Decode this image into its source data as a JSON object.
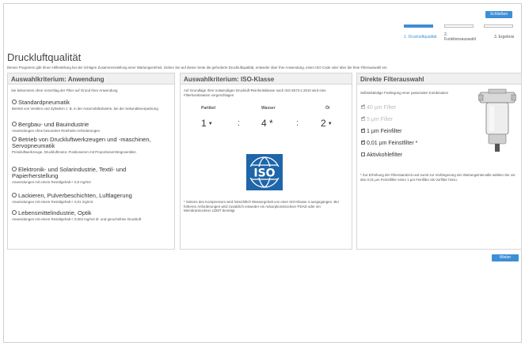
{
  "header": {
    "close_label": "Schließen"
  },
  "steps": [
    {
      "label": "1. Druckluftqualität",
      "active": true
    },
    {
      "label": "2. Funktionsauswahl",
      "active": false
    },
    {
      "label": "3. Ergebnis",
      "active": false
    }
  ],
  "page": {
    "title": "Druckluftqualität",
    "intro": "Dieses Programm gibt Ihnen Hilfestellung bei der richtigen Zusammenstellung einer Wartungseinheit. Geben Sie auf dieser Seite die geforderte Druckluftqualität, entweder über Ihre Anwendung, einen ISO Code oder über die freie Filterauswahl ein."
  },
  "panel_application": {
    "title": "Auswahlkriterium: Anwendung",
    "subtitle": "Sie bekommen ohne Vorschlag der Filter auf Grund Ihrer Anwendung",
    "options": [
      {
        "label": "Standardpneumatik",
        "desc": "Betrieb von Ventilen und Zylindern z. B. in der Automobilindustrie, bei der Sekundärverpackung"
      },
      {
        "label": "Bergbau- und Bauindustrie",
        "desc": "Anwendungen ohne besondere Reinheits-Anforderungen"
      },
      {
        "label": "Betrieb von Druckluftwerkzeugen und -maschinen, Servopneumatik",
        "desc": "Pressluftwerkzeuge, Druckluftmotor, Positionieren mit Proportional-Wegeventilen"
      },
      {
        "label": "Elektronik- und Solarindustrie, Textil- und Papierherstellung",
        "desc": "Anwendungen mit einem Restölgehalt < 0,5 mg/m3"
      },
      {
        "label": "Lackieren, Pulverbeschichten, Luftlagerung",
        "desc": "Anwendungen mit einem Restölgehalt < 0,01 mg/m3"
      },
      {
        "label": "Lebensmittelindustrie, Optik",
        "desc": "Anwendungen mit einem Restölgehalt < 0,003 mg/m3 öl- und geruchsfreie Druckluft"
      }
    ]
  },
  "panel_iso": {
    "title": "Auswahlkriterium: ISO-Klasse",
    "subtitle": "Auf Grundlage Ihrer notwendigen Druckluft-Reinheitsklasse nach ISO 8573-1:2010 wird eine Filterkombination vorgeschlagen",
    "cols": [
      {
        "label": "Partikel",
        "value": "1"
      },
      {
        "label": "Wasser",
        "value": "4 *"
      },
      {
        "label": "Öl",
        "value": "2"
      }
    ],
    "logo_text": "ISO",
    "footnote": "* Seitens des Kompressors wird hinsichtlich Wassergehalt von einer ISO-Klasse 4 ausgegangen. Bei höheren Anforderungen wird zusätzlich entweder ein Adsorptionstrockner PDAD oder ein Membrantrockner LDMT benötigt"
  },
  "panel_filter": {
    "title": "Direkte Filterauswahl",
    "subtitle": "Selbstständige Festlegung einer passenden Kombination",
    "filters": [
      {
        "label": "40 µm Filter",
        "checked": true,
        "disabled": true
      },
      {
        "label": "5 µm Filter",
        "checked": true,
        "disabled": true
      },
      {
        "label": "1 µm Feinfilter",
        "checked": true,
        "disabled": false
      },
      {
        "label": "0,01 µm Feinstfilter *",
        "checked": true,
        "disabled": false
      },
      {
        "label": "Aktivkohlefilter",
        "checked": false,
        "disabled": false
      }
    ],
    "footnote": "* Zur Erhöhung der Filterstandzeit und somit zur Verlängerung der Wartungsintervalle wählen Sie vor den 0,01 µm Feinstfilter einen 1 µm Feinfilter als Vorfilter hinzu."
  },
  "footer": {
    "next_label": "Weiter"
  },
  "colors": {
    "accent": "#3d8fd6",
    "iso_blue": "#1e66a9"
  }
}
